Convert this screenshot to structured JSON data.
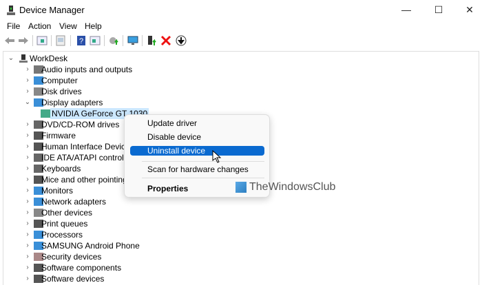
{
  "window": {
    "title": "Device Manager",
    "minimize": "—",
    "maximize": "☐",
    "close": "✕"
  },
  "menubar": [
    "File",
    "Action",
    "View",
    "Help"
  ],
  "toolbar": {
    "icons": [
      "back-icon",
      "forward-icon",
      "show-hide-console-tree-icon",
      "properties-icon",
      "help-icon",
      "action-pane-icon",
      "update-driver-icon",
      "scan-hardware-icon",
      "enable-device-icon",
      "uninstall-device-icon",
      "disable-device-icon"
    ]
  },
  "tree": {
    "root": "WorkDesk",
    "items": [
      {
        "label": "Audio inputs and outputs",
        "expanded": false
      },
      {
        "label": "Computer",
        "expanded": false
      },
      {
        "label": "Disk drives",
        "expanded": false
      },
      {
        "label": "Display adapters",
        "expanded": true,
        "children": [
          "NVIDIA GeForce GT 1030"
        ]
      },
      {
        "label": "DVD/CD-ROM drives",
        "expanded": false
      },
      {
        "label": "Firmware",
        "expanded": false
      },
      {
        "label": "Human Interface Devices",
        "expanded": false
      },
      {
        "label": "IDE ATA/ATAPI controllers",
        "expanded": false
      },
      {
        "label": "Keyboards",
        "expanded": false
      },
      {
        "label": "Mice and other pointing devices",
        "expanded": false
      },
      {
        "label": "Monitors",
        "expanded": false
      },
      {
        "label": "Network adapters",
        "expanded": false
      },
      {
        "label": "Other devices",
        "expanded": false
      },
      {
        "label": "Print queues",
        "expanded": false
      },
      {
        "label": "Processors",
        "expanded": false
      },
      {
        "label": "SAMSUNG Android Phone",
        "expanded": false
      },
      {
        "label": "Security devices",
        "expanded": false
      },
      {
        "label": "Software components",
        "expanded": false
      },
      {
        "label": "Software devices",
        "expanded": false
      }
    ]
  },
  "context_menu": {
    "items": [
      "Update driver",
      "Disable device",
      "Uninstall device",
      "Scan for hardware changes",
      "Properties"
    ],
    "highlighted": "Uninstall device"
  },
  "watermark": "TheWindowsClub",
  "colors": {
    "accent": "#0a6ad0",
    "selection": "#cce8ff"
  }
}
